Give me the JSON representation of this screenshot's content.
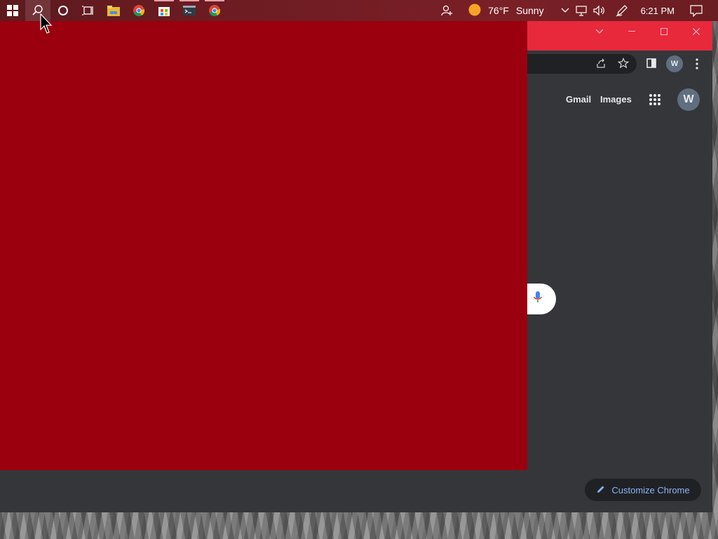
{
  "taskbar": {
    "time": "6:21 PM",
    "weather": {
      "temp": "76°F",
      "condition": "Sunny"
    },
    "apps": [
      {
        "icon": "windows-start-icon"
      },
      {
        "icon": "search-icon"
      },
      {
        "icon": "cortana-icon"
      },
      {
        "icon": "task-view-icon"
      },
      {
        "icon": "file-explorer-icon"
      },
      {
        "icon": "chrome-icon"
      },
      {
        "icon": "store-icon"
      },
      {
        "icon": "terminal-icon"
      },
      {
        "icon": "chrome-canary-icon"
      }
    ]
  },
  "browser": {
    "profile_initial": "W",
    "links": {
      "gmail": "Gmail",
      "images": "Images"
    },
    "account_initial": "W",
    "customize_label": "Customize Chrome"
  },
  "colors": {
    "overlay": "#9a000d",
    "titlebar": "#e8283b",
    "page_bg": "#35363a",
    "link_blue": "#8ab4f8"
  }
}
